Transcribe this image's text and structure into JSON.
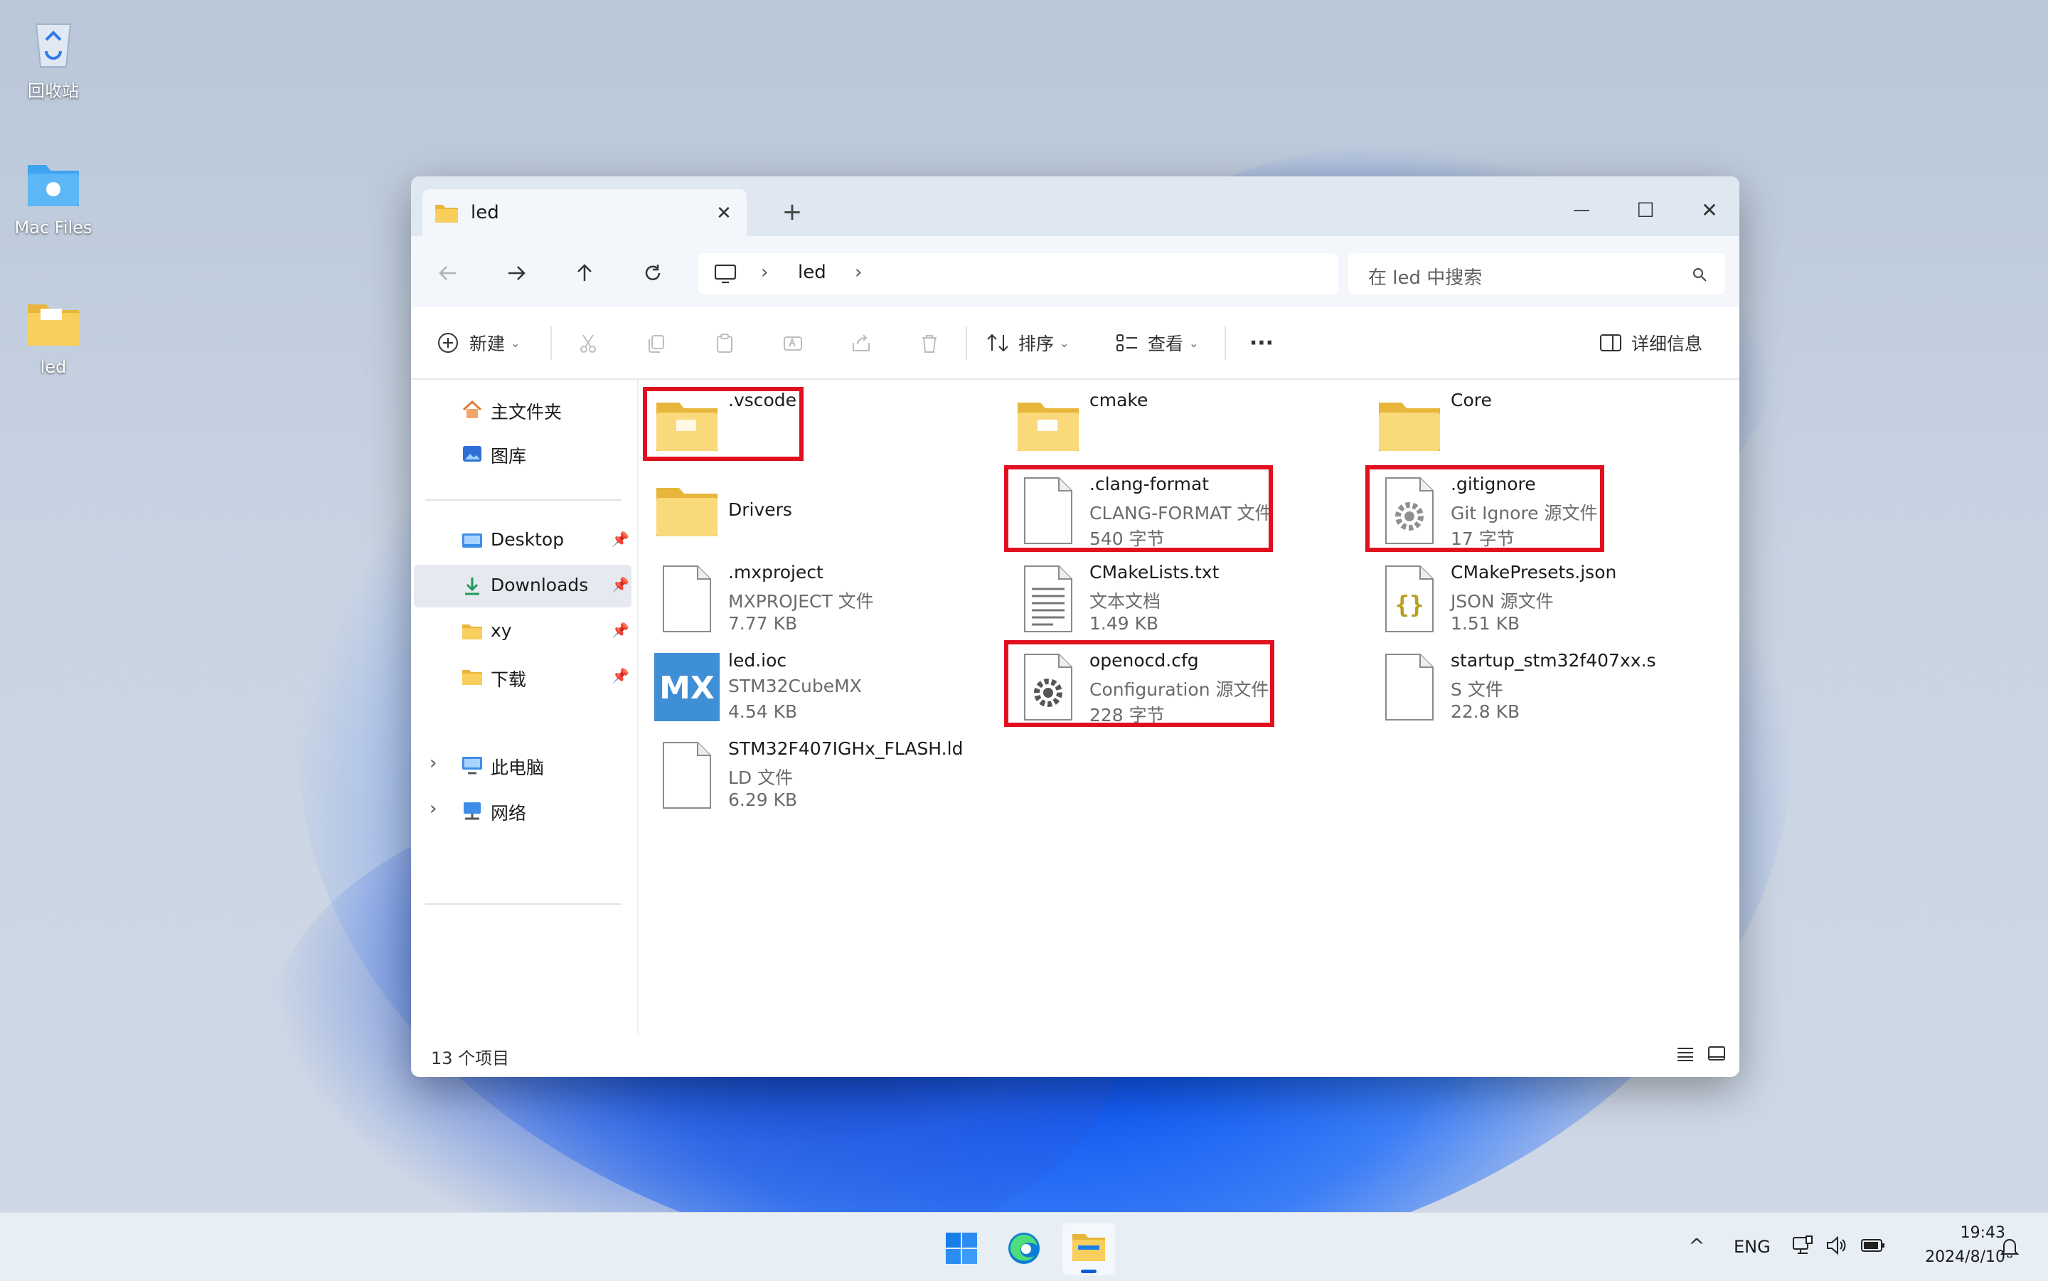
{
  "desktop": {
    "icons": [
      {
        "label": "回收站",
        "icon": "recycle-bin-icon"
      },
      {
        "label": "Mac Files",
        "icon": "mac-folder-icon"
      },
      {
        "label": "led",
        "icon": "folder-icon"
      }
    ]
  },
  "window": {
    "tab_title": "led",
    "tab_icon": "folder-icon",
    "new_tab": "+",
    "controls": {
      "minimize": "—",
      "maximize": "☐",
      "close": "✕"
    },
    "address": {
      "breadcrumbs": [
        "led"
      ],
      "computer_icon": "monitor-icon"
    },
    "search_placeholder": "在 led 中搜索",
    "toolbar": {
      "new_label": "新建",
      "sort_label": "排序",
      "view_label": "查看",
      "more_label": "···",
      "details_label": "详细信息"
    },
    "nav": {
      "top": [
        {
          "label": "主文件夹",
          "icon": "home-icon"
        },
        {
          "label": "图库",
          "icon": "gallery-icon"
        }
      ],
      "pinned": [
        {
          "label": "Desktop",
          "icon": "desktop-folder-icon",
          "selected": false
        },
        {
          "label": "Downloads",
          "icon": "download-icon",
          "selected": true
        },
        {
          "label": "xy",
          "icon": "folder-icon",
          "selected": false
        },
        {
          "label": "下载",
          "icon": "folder-icon",
          "selected": false
        }
      ],
      "bottom": [
        {
          "label": "此电脑",
          "icon": "pc-icon"
        },
        {
          "label": "网络",
          "icon": "network-icon"
        }
      ]
    },
    "files": [
      {
        "name": ".vscode",
        "type": "",
        "size": "",
        "icon": "folder-icon",
        "highlight": true
      },
      {
        "name": "cmake",
        "type": "",
        "size": "",
        "icon": "folder-icon",
        "highlight": false
      },
      {
        "name": "Core",
        "type": "",
        "size": "",
        "icon": "folder-icon",
        "highlight": false
      },
      {
        "name": "Drivers",
        "type": "",
        "size": "",
        "icon": "folder-icon",
        "highlight": false
      },
      {
        "name": ".clang-format",
        "type": "CLANG-FORMAT 文件",
        "size": "540 字节",
        "icon": "file-icon",
        "highlight": true
      },
      {
        "name": ".gitignore",
        "type": "Git Ignore 源文件",
        "size": "17 字节",
        "icon": "gear-file-icon",
        "highlight": true
      },
      {
        "name": ".mxproject",
        "type": "MXPROJECT 文件",
        "size": "7.77 KB",
        "icon": "file-icon",
        "highlight": false
      },
      {
        "name": "CMakeLists.txt",
        "type": "文本文档",
        "size": "1.49 KB",
        "icon": "text-file-icon",
        "highlight": false
      },
      {
        "name": "CMakePresets.json",
        "type": "JSON 源文件",
        "size": "1.51 KB",
        "icon": "json-file-icon",
        "highlight": false
      },
      {
        "name": "led.ioc",
        "type": "STM32CubeMX",
        "size": "4.54 KB",
        "icon": "mx-icon",
        "highlight": false
      },
      {
        "name": "openocd.cfg",
        "type": "Configuration 源文件",
        "size": "228 字节",
        "icon": "gear-file-icon",
        "highlight": true
      },
      {
        "name": "startup_stm32f407xx.s",
        "type": "S 文件",
        "size": "22.8 KB",
        "icon": "file-icon",
        "highlight": false
      },
      {
        "name": "STM32F407IGHx_FLASH.ld",
        "type": "LD 文件",
        "size": "6.29 KB",
        "icon": "file-icon",
        "highlight": false
      }
    ],
    "status_count": "13 个项目"
  },
  "taskbar": {
    "apps": [
      {
        "name": "start-button",
        "icon": "windows-icon"
      },
      {
        "name": "edge",
        "icon": "edge-icon"
      },
      {
        "name": "file-explorer",
        "icon": "file-explorer-icon"
      }
    ],
    "tray": {
      "chevron": "^",
      "lang": "ENG",
      "time": "19:43",
      "date": "2024/8/10"
    }
  },
  "colors": {
    "highlight_box": "#e0101e",
    "folder_yellow": "#f8c94a",
    "accent_blue": "#0a5bd6"
  }
}
